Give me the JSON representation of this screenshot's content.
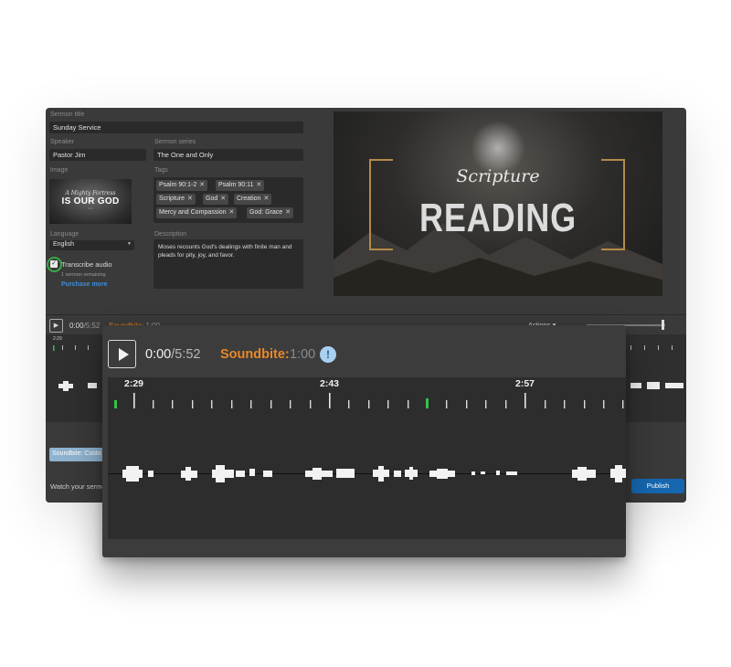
{
  "form": {
    "sermon_title_label": "Sermon title",
    "sermon_title": "Sunday Service",
    "speaker_label": "Speaker",
    "speaker": "Pastor Jim",
    "series_label": "Sermon series",
    "series": "The One and Only",
    "image_label": "Image",
    "image_text_small": "A Mighty Fortress",
    "image_text_big": "IS OUR GOD",
    "tags_label": "Tags",
    "tags": [
      "Psalm 90:1-2",
      "Psalm 90:11",
      "Scripture",
      "God",
      "Creation",
      "Mercy and Compassion",
      "God: Grace"
    ],
    "tag_remove_glyph": "✕",
    "language_label": "Language",
    "language": "English",
    "transcribe_label": "Transcribe audio",
    "remaining": "1 sermon remaining",
    "purchase": "Purchase more",
    "description_label": "Description",
    "description": "Moses recounts God's dealings with finite man and pleads for pity, joy, and favor."
  },
  "hero": {
    "script_text": "Scripture",
    "big_text": "READING"
  },
  "bg_player": {
    "time_current": "0:00",
    "time_total": "/5:52",
    "soundbite": "Soundbite:",
    "soundbite_value": "1:00",
    "actions": "Actions ▾",
    "first_tick": "2:29"
  },
  "bottom": {
    "soundbite_chip": "Soundbite: Custo",
    "watch_text": "Watch your sermo",
    "publish": "Publish"
  },
  "zoom": {
    "time_current": "0:00",
    "time_total": "/5:52",
    "soundbite": "Soundbite:",
    "soundbite_value": "1:00",
    "info_glyph": "!",
    "tick_labels": [
      "2:29",
      "2:43",
      "2:57"
    ]
  },
  "colors": {
    "accent_orange": "#e8882a",
    "publish_blue": "#1667b0",
    "marker_green": "#35c24a",
    "check_ring_green": "#39a845"
  }
}
